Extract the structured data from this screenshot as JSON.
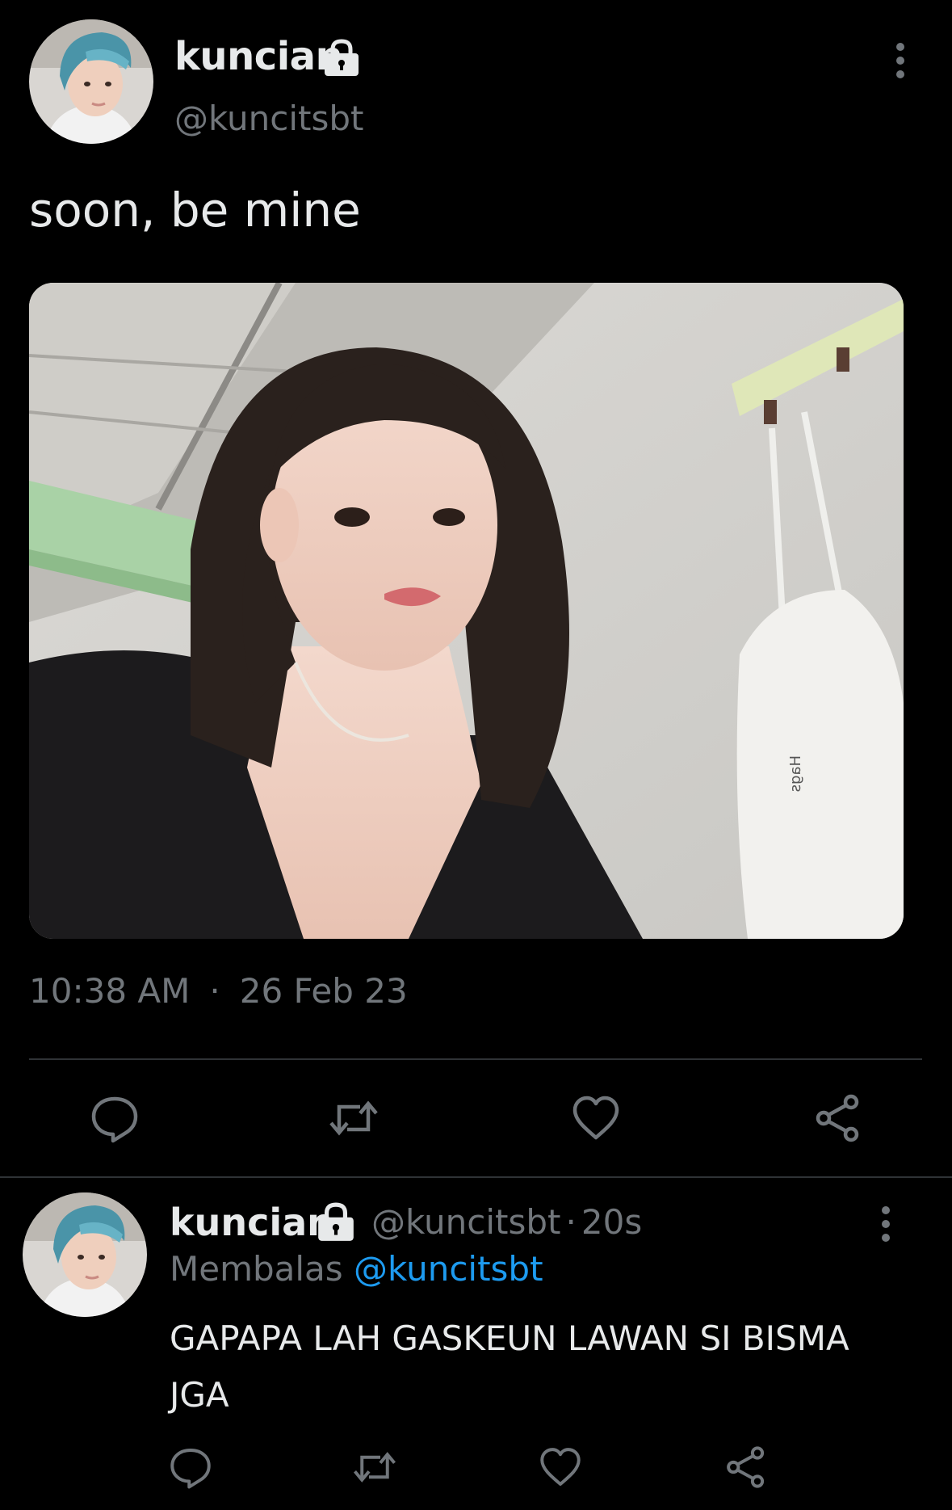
{
  "main_tweet": {
    "display_name": "kuncian",
    "handle": "@kuncitsbt",
    "protected_icon": "lock-icon",
    "more_icon": "more-vertical-icon",
    "text": "soon, be mine",
    "time": "10:38 AM",
    "separator": "·",
    "date": "26 Feb 23",
    "photo_embedded_text": "Hags",
    "actions": {
      "reply_icon": "reply-icon",
      "retweet_icon": "retweet-icon",
      "like_icon": "like-icon",
      "share_icon": "share-icon"
    }
  },
  "reply": {
    "display_name": "kuncian",
    "handle": "@kuncitsbt",
    "time_sep": "·",
    "time": "20s",
    "replying_prefix": "Membalas",
    "replying_to": "@kuncitsbt",
    "text": "GAPAPA LAH GASKEUN LAWAN SI BISMA JGA",
    "actions": {
      "reply_icon": "reply-icon",
      "retweet_icon": "retweet-icon",
      "like_icon": "like-icon",
      "share_icon": "share-icon"
    }
  },
  "colors": {
    "background": "#000000",
    "primary_text": "#e7e9ea",
    "secondary_text": "#71767b",
    "link": "#1d9bf0",
    "divider": "#2f3336"
  }
}
